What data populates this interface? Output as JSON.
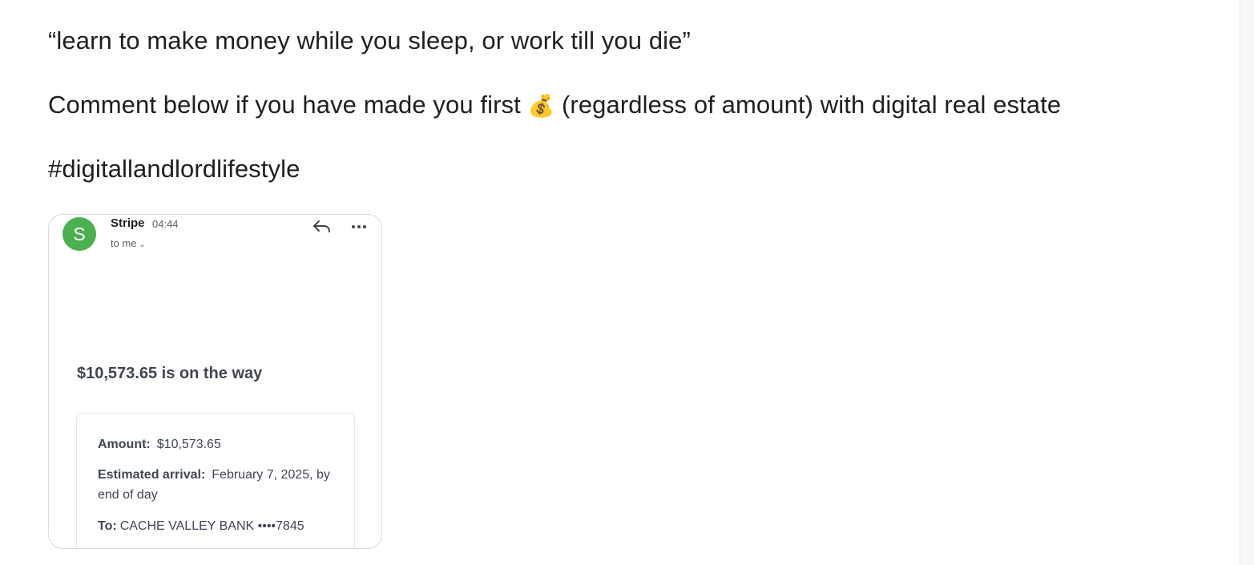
{
  "post": {
    "line1": "“learn to make money while you sleep, or work till you die”",
    "line2_before": "Comment below if you have made you first",
    "line2_emoji": "💰",
    "line2_after": "(regardless of amount) with digital real estate",
    "hashtag": "#digitallandlordlifestyle"
  },
  "email": {
    "avatar_letter": "S",
    "avatar_color": "#4caf50",
    "sender": "Stripe",
    "time": "04:44",
    "recipient": "to me",
    "reply_icon": "reply-icon",
    "more_icon": "more-horizontal-icon",
    "headline": "$10,573.65 is on the way",
    "details": {
      "amount_label": "Amount:",
      "amount_value": "$10,573.65",
      "arrival_label": "Estimated arrival:",
      "arrival_value": "February 7, 2025, by end of day",
      "to_label": "To:",
      "to_value": "CACHE VALLEY BANK ••••7845"
    }
  }
}
